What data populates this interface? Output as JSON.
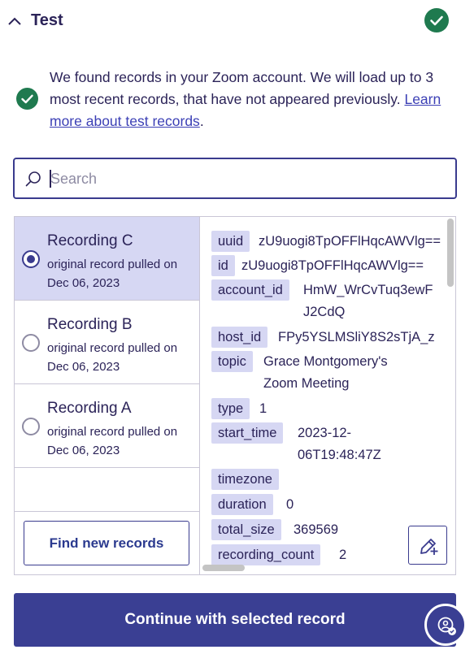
{
  "header": {
    "title": "Test"
  },
  "info": {
    "text": "We found records in your Zoom account. We will load up to 3 most recent records, that have not appeared previously.",
    "link": "Learn more about test records",
    "suffix": "."
  },
  "search": {
    "placeholder": "Search",
    "value": ""
  },
  "records": [
    {
      "name": "Recording C",
      "sub": "original record pulled on Dec 06, 2023",
      "selected": true
    },
    {
      "name": "Recording B",
      "sub": "original record pulled on Dec 06, 2023",
      "selected": false
    },
    {
      "name": "Recording A",
      "sub": "original record pulled on Dec 06, 2023",
      "selected": false
    }
  ],
  "find_button": "Find new records",
  "fields": [
    {
      "key": "uuid",
      "value": "zU9uogi8TpOFFlHqcAWVlg=="
    },
    {
      "key": "id",
      "value": "zU9uogi8TpOFFlHqcAWVlg=="
    },
    {
      "key": "account_id",
      "value": [
        "HmW_WrCvTuq3ewF",
        "J2CdQ"
      ]
    },
    {
      "key": "host_id",
      "value": "FPy5YSLMSliY8S2sTjA_z"
    },
    {
      "key": "topic",
      "value": [
        "Grace Montgomery's",
        "Zoom Meeting"
      ]
    },
    {
      "key": "type",
      "value": "1"
    },
    {
      "key": "start_time",
      "value": [
        "2023-12-",
        "06T19:48:47Z"
      ]
    },
    {
      "key": "timezone",
      "value": ""
    },
    {
      "key": "duration",
      "value": "0"
    },
    {
      "key": "total_size",
      "value": "369569"
    },
    {
      "key": "recording_count",
      "value": "2"
    }
  ],
  "continue_button": "Continue with selected record",
  "colors": {
    "primary": "#3a3f93",
    "success": "#1f7a4f",
    "selected_bg": "#d6d7f3",
    "text": "#2b2358"
  },
  "icons": [
    "chevron-up-icon",
    "check-circle-icon",
    "search-icon",
    "radio-icon",
    "edit-icon",
    "help-icon"
  ]
}
